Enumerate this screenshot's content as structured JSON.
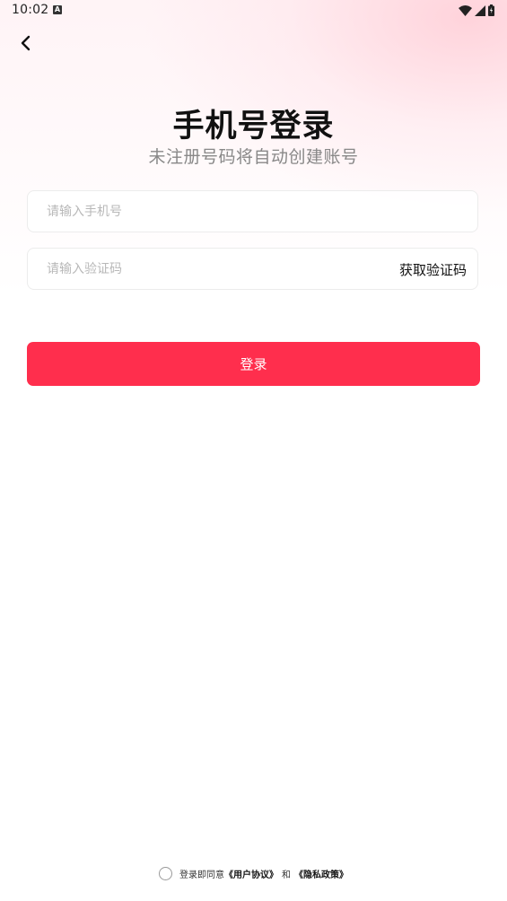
{
  "status_bar": {
    "time": "10:02",
    "notification_letter": "A"
  },
  "header": {
    "title": "手机号登录",
    "subtitle": "未注册号码将自动创建账号"
  },
  "form": {
    "phone_placeholder": "请输入手机号",
    "phone_value": "",
    "code_placeholder": "请输入验证码",
    "code_value": "",
    "get_code_label": "获取验证码",
    "login_label": "登录"
  },
  "agreement": {
    "prefix": "登录即同意",
    "user_agreement": "《用户协议》",
    "and": "和",
    "privacy_policy": "《隐私政策》",
    "checked": false
  },
  "colors": {
    "accent": "#ff2e4d",
    "placeholder": "#b8b8b8",
    "subtitle": "#888888"
  },
  "icons": {
    "back": "chevron-left-icon",
    "wifi": "wifi-icon",
    "signal": "signal-icon",
    "battery": "battery-icon"
  }
}
